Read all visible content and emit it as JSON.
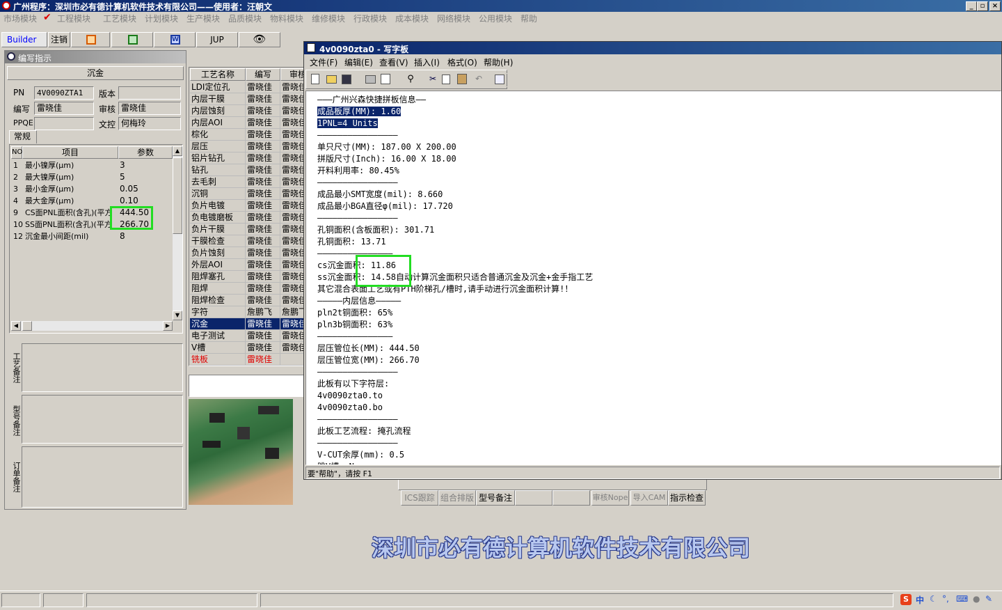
{
  "app": {
    "title": "广州程序：深圳市必有德计算机软件技术有限公司——使用者：汪朝文"
  },
  "menubar": [
    "市场模块",
    "工程模块",
    "工艺模块",
    "计划模块",
    "生产模块",
    "品质模块",
    "物料模块",
    "维修模块",
    "行政模块",
    "成本模块",
    "网络模块",
    "公用模块",
    "帮助"
  ],
  "toolbar": {
    "builder": "Builder",
    "logout": "注销",
    "jup": "JUP"
  },
  "panel": {
    "title": "编写指示",
    "section": "沉金",
    "pn_label": "PN",
    "pn_value": "4V0090ZTA1",
    "version_label": "版本",
    "version_value": "",
    "author_label": "编写",
    "author_value": "雷晓佳",
    "review_label": "审核",
    "review_value": "雷晓佳",
    "pnqe_label": "PPQE",
    "pnqe_value": "",
    "doc_label": "文控",
    "doc_value": "何梅玲",
    "tab": "常规",
    "grid_headers": [
      "NO",
      "项目",
      "参数"
    ],
    "rows": [
      {
        "no": "1",
        "item": "最小镍厚(μm)",
        "param": "3"
      },
      {
        "no": "2",
        "item": "最大镍厚(μm)",
        "param": "5"
      },
      {
        "no": "3",
        "item": "最小金厚(μm)",
        "param": "0.05"
      },
      {
        "no": "4",
        "item": "最大金厚(μm)",
        "param": "0.10"
      },
      {
        "no": "9",
        "item": "CS面PNL面积(含孔)(平方",
        "param": "444.50"
      },
      {
        "no": "10",
        "item": "SS面PNL面积(含孔)(平方",
        "param": "266.70"
      },
      {
        "no": "12",
        "item": "沉金最小间距(mil)",
        "param": "8"
      }
    ],
    "notes": [
      "工艺备注",
      "型号备注",
      "订单备注"
    ]
  },
  "process": {
    "headers": [
      "工艺名称",
      "编写",
      "审核"
    ],
    "rows": [
      {
        "name": "LDI定位孔",
        "w": "雷晓佳",
        "r": "雷晓佳"
      },
      {
        "name": "内层干膜",
        "w": "雷晓佳",
        "r": "雷晓佳"
      },
      {
        "name": "内层蚀刻",
        "w": "雷晓佳",
        "r": "雷晓佳"
      },
      {
        "name": "内层AOI",
        "w": "雷晓佳",
        "r": "雷晓佳"
      },
      {
        "name": "棕化",
        "w": "雷晓佳",
        "r": "雷晓佳"
      },
      {
        "name": "层压",
        "w": "雷晓佳",
        "r": "雷晓佳"
      },
      {
        "name": "铝片钻孔",
        "w": "雷晓佳",
        "r": "雷晓佳"
      },
      {
        "name": "钻孔",
        "w": "雷晓佳",
        "r": "雷晓佳"
      },
      {
        "name": "去毛刺",
        "w": "雷晓佳",
        "r": "雷晓佳"
      },
      {
        "name": "沉铜",
        "w": "雷晓佳",
        "r": "雷晓佳"
      },
      {
        "name": "负片电镀",
        "w": "雷晓佳",
        "r": "雷晓佳"
      },
      {
        "name": "负电镀磨板",
        "w": "雷晓佳",
        "r": "雷晓佳"
      },
      {
        "name": "负片干膜",
        "w": "雷晓佳",
        "r": "雷晓佳"
      },
      {
        "name": "干膜检查",
        "w": "雷晓佳",
        "r": "雷晓佳"
      },
      {
        "name": "负片蚀刻",
        "w": "雷晓佳",
        "r": "雷晓佳"
      },
      {
        "name": "外层AOI",
        "w": "雷晓佳",
        "r": "雷晓佳"
      },
      {
        "name": "阻焊塞孔",
        "w": "雷晓佳",
        "r": "雷晓佳"
      },
      {
        "name": "阻焊",
        "w": "雷晓佳",
        "r": "雷晓佳"
      },
      {
        "name": "阻焊检查",
        "w": "雷晓佳",
        "r": "雷晓佳"
      },
      {
        "name": "字符",
        "w": "詹鹏飞",
        "r": "詹鹏飞"
      },
      {
        "name": "沉金",
        "w": "雷晓佳",
        "r": "雷晓佳"
      },
      {
        "name": "电子测试",
        "w": "雷晓佳",
        "r": "雷晓佳"
      },
      {
        "name": "V槽",
        "w": "雷晓佳",
        "r": "雷晓佳"
      },
      {
        "name": "铣板",
        "w": "雷晓佳",
        "r": ""
      }
    ]
  },
  "bottom_buttons": [
    "ICS跟踪",
    "组合排版",
    "型号备注",
    "",
    "",
    "审核Nope",
    "导入CAM",
    "指示检查"
  ],
  "wordpad": {
    "title": "4v0090zta0 - 写字板",
    "menu": [
      "文件(F)",
      "编辑(E)",
      "查看(V)",
      "插入(I)",
      "格式(O)",
      "帮助(H)"
    ],
    "lines": [
      "———广州兴森快捷拼板信息——",
      "成品板厚(MM): 1.60",
      "1PNL=4 Units",
      "————————————————",
      "单只尺寸(MM): 187.00 X 200.00",
      "拼版尺寸(Inch): 16.00 X 18.00",
      "开料利用率: 80.45%",
      "————————————————",
      "成品最小SMT宽度(mil): 8.660",
      "成品最小BGA直径φ(mil): 17.720",
      "————————————————",
      "孔铜面积(含板面积): 301.71",
      "孔铜面积: 13.71",
      "———————————————",
      "cs沉金面积: 11.86",
      "ss沉金面积: 14.58自动计算沉金面积只适合普通沉金及沉金+金手指工艺",
      "其它混合表面工艺或有PTH阶梯孔/槽时,请手动进行沉金面积计算!！",
      "—————内层信息—————",
      "pln2t铜面积: 65%",
      "pln3b铜面积: 63%",
      "———————————————",
      "层压管位长(MM): 444.50",
      "层压管位宽(MM): 266.70",
      "————————————————",
      "此板有以下字符层:",
      "4v0090zta0.to",
      "4v0090zta0.bo",
      "————————————————",
      "此板工艺流程: 掩孔流程",
      "————————————————",
      "V-CUT余厚(mm): 0.5",
      "跳V槽: N"
    ],
    "status": "要\"帮助\"，请按 F1"
  },
  "banner": "深圳市必有德计算机软件技术有限公司",
  "tray": {
    "ime": "中"
  }
}
